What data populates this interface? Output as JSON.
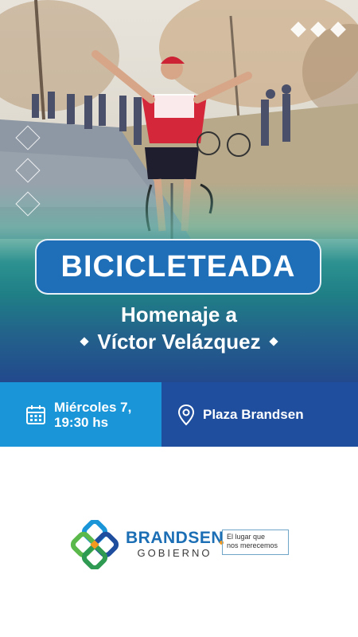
{
  "event": {
    "title": "BICICLETEADA",
    "subtitle_line1": "Homenaje a",
    "subtitle_line2": "Víctor Velázquez"
  },
  "info": {
    "date_line1": "Miércoles 7,",
    "date_line2": "19:30 hs",
    "date_icon": "calendar-icon",
    "location": "Plaza Brandsen",
    "location_icon": "map-pin-icon"
  },
  "branding": {
    "name": "BRANDSEN",
    "sub": "GOBIERNO",
    "tagline_line1": "El lugar que",
    "tagline_line2": "nos merecemos"
  },
  "colors": {
    "title_pill": "#1f6fb8",
    "info_left": "#1a95d8",
    "info_right": "#1f4e9e",
    "brand_blue": "#1c6fb5",
    "tag_dot": "#f39a1e"
  }
}
